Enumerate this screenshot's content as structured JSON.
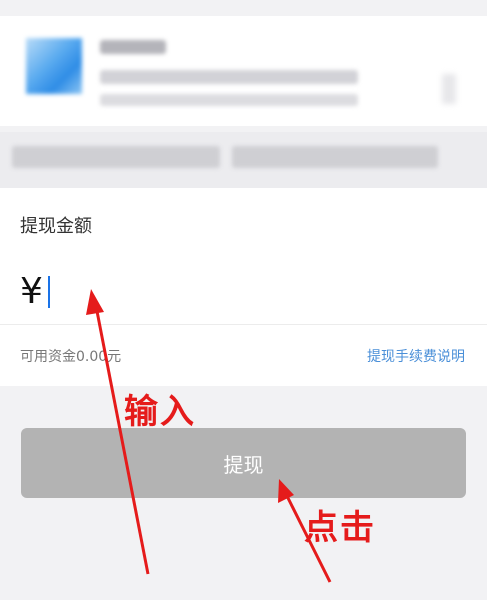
{
  "form": {
    "field_title": "提现金额",
    "currency_symbol": "¥",
    "amount_value": "",
    "balance_text": "可用资金0.00元",
    "fee_link": "提现手续费说明"
  },
  "action": {
    "withdraw_label": "提现"
  },
  "annotations": {
    "input_label": "输入",
    "click_label": "点击",
    "color": "#e51b1b"
  },
  "colors": {
    "page_background": "#f2f2f4",
    "button_disabled": "#b3b3b3",
    "link": "#4a8fd8"
  }
}
